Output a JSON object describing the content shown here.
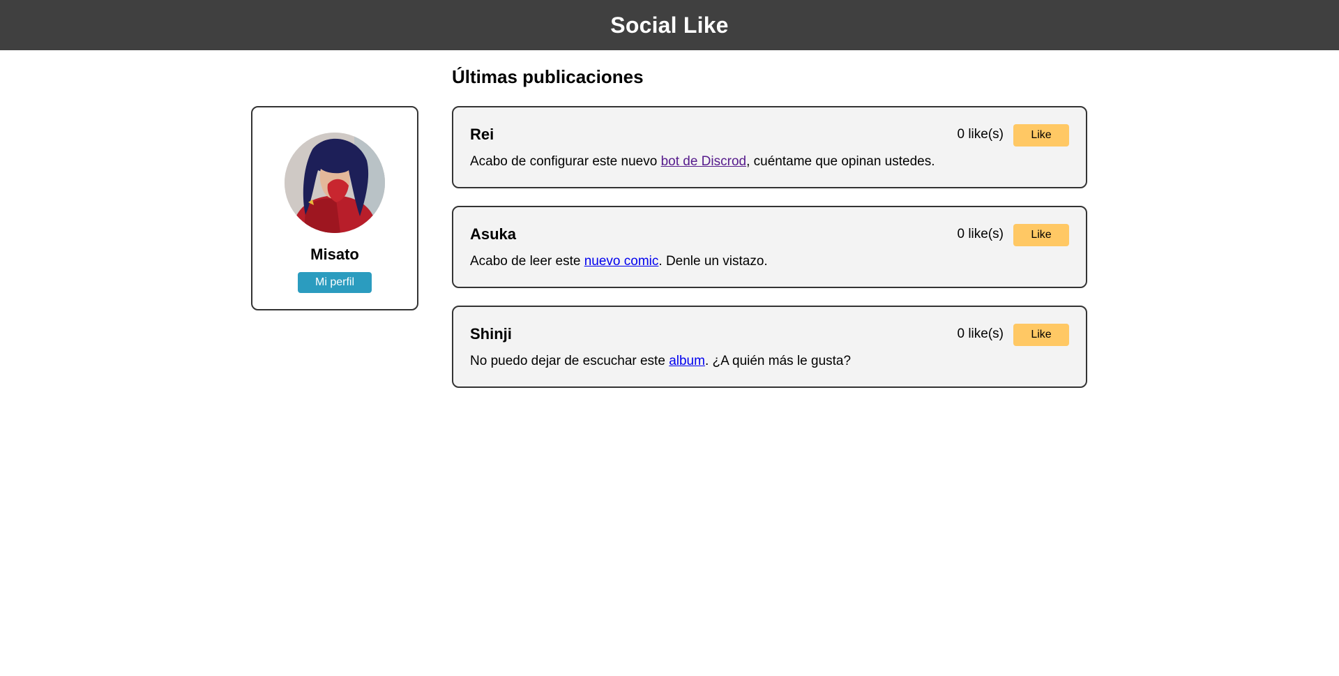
{
  "app": {
    "title": "Social Like"
  },
  "profile": {
    "name": "Misato",
    "button_label": "Mi perfil"
  },
  "feed": {
    "title": "Últimas publicaciones",
    "posts": [
      {
        "author": "Rei",
        "likes": "0 like(s)",
        "like_label": "Like",
        "text_before": "Acabo de configurar este nuevo ",
        "link_text": "bot de Discrod",
        "text_after": ", cuéntame que opinan ustedes."
      },
      {
        "author": "Asuka",
        "likes": "0 like(s)",
        "like_label": "Like",
        "text_before": "Acabo de leer este ",
        "link_text": "nuevo comic",
        "text_after": ". Denle un vistazo."
      },
      {
        "author": "Shinji",
        "likes": "0 like(s)",
        "like_label": "Like",
        "text_before": "No puedo dejar de escuchar este ",
        "link_text": "album",
        "text_after": ". ¿A quién más le gusta?"
      }
    ]
  },
  "colors": {
    "header_bg": "#404040",
    "profile_button": "#2b9cbf",
    "like_button": "#ffc864",
    "post_bg": "#f3f3f3"
  }
}
